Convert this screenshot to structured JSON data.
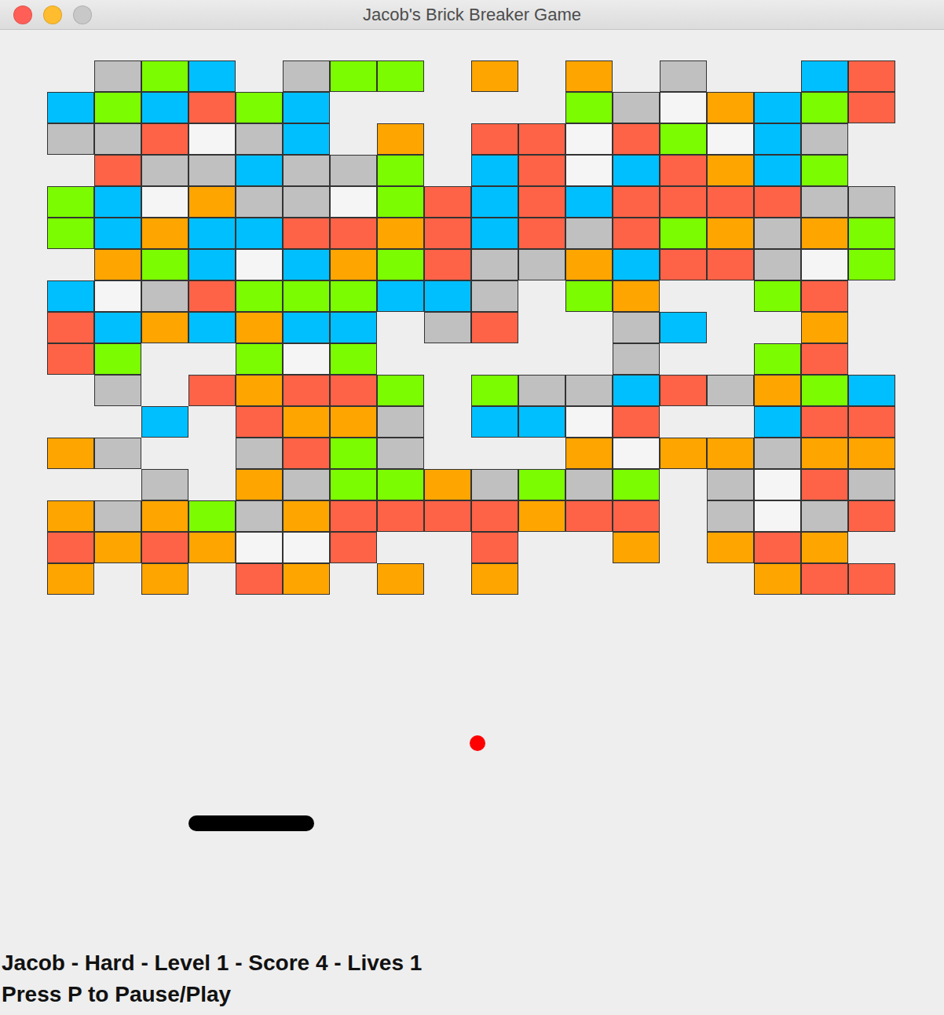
{
  "window": {
    "title": "Jacob's Brick Breaker Game",
    "controls": [
      {
        "color": "#ff5f57"
      },
      {
        "color": "#febc2e"
      },
      {
        "color": "#c8c8c8"
      }
    ]
  },
  "bricks": [
    [
      null,
      "#c0c0c0",
      "#7cfc00",
      "#00bfff",
      null,
      "#c0c0c0",
      "#7cfc00",
      "#7cfc00",
      null,
      "#ffa500",
      null,
      "#ffa500",
      null,
      "#c0c0c0",
      null,
      null,
      "#00bfff",
      "#ff6347"
    ],
    [
      "#00bfff",
      "#7cfc00",
      "#00bfff",
      "#ff6347",
      "#7cfc00",
      "#00bfff",
      null,
      null,
      null,
      null,
      null,
      "#7cfc00",
      "#c0c0c0",
      "#f5f5f5",
      "#ffa500",
      "#00bfff",
      "#7cfc00",
      "#ff6347"
    ],
    [
      "#c0c0c0",
      "#c0c0c0",
      "#ff6347",
      "#f5f5f5",
      "#c0c0c0",
      "#00bfff",
      null,
      "#ffa500",
      null,
      "#ff6347",
      "#ff6347",
      "#f5f5f5",
      "#ff6347",
      "#7cfc00",
      "#f5f5f5",
      "#00bfff",
      "#c0c0c0",
      null
    ],
    [
      null,
      "#ff6347",
      "#c0c0c0",
      "#c0c0c0",
      "#00bfff",
      "#c0c0c0",
      "#c0c0c0",
      "#7cfc00",
      null,
      "#00bfff",
      "#ff6347",
      "#f5f5f5",
      "#00bfff",
      "#ff6347",
      "#ffa500",
      "#00bfff",
      "#7cfc00",
      null
    ],
    [
      "#7cfc00",
      "#00bfff",
      "#f5f5f5",
      "#ffa500",
      "#c0c0c0",
      "#c0c0c0",
      "#f5f5f5",
      "#7cfc00",
      "#ff6347",
      "#00bfff",
      "#ff6347",
      "#00bfff",
      "#ff6347",
      "#ff6347",
      "#ff6347",
      "#ff6347",
      "#c0c0c0",
      "#c0c0c0"
    ],
    [
      "#7cfc00",
      "#00bfff",
      "#ffa500",
      "#00bfff",
      "#00bfff",
      "#ff6347",
      "#ff6347",
      "#ffa500",
      "#ff6347",
      "#00bfff",
      "#ff6347",
      "#c0c0c0",
      "#ff6347",
      "#7cfc00",
      "#ffa500",
      "#c0c0c0",
      "#ffa500",
      "#7cfc00"
    ],
    [
      null,
      "#ffa500",
      "#7cfc00",
      "#00bfff",
      "#f5f5f5",
      "#00bfff",
      "#ffa500",
      "#7cfc00",
      "#ff6347",
      "#c0c0c0",
      "#c0c0c0",
      "#ffa500",
      "#00bfff",
      "#ff6347",
      "#ff6347",
      "#c0c0c0",
      "#f5f5f5",
      "#7cfc00"
    ],
    [
      "#00bfff",
      "#f5f5f5",
      "#c0c0c0",
      "#ff6347",
      "#7cfc00",
      "#7cfc00",
      "#7cfc00",
      "#00bfff",
      "#00bfff",
      "#c0c0c0",
      null,
      "#7cfc00",
      "#ffa500",
      null,
      null,
      "#7cfc00",
      "#ff6347",
      null
    ],
    [
      "#ff6347",
      "#00bfff",
      "#ffa500",
      "#00bfff",
      "#ffa500",
      "#00bfff",
      "#00bfff",
      null,
      "#c0c0c0",
      "#ff6347",
      null,
      null,
      "#c0c0c0",
      "#00bfff",
      null,
      null,
      "#ffa500",
      null
    ],
    [
      "#ff6347",
      "#7cfc00",
      null,
      null,
      "#7cfc00",
      "#f5f5f5",
      "#7cfc00",
      null,
      null,
      null,
      null,
      null,
      "#c0c0c0",
      null,
      null,
      "#7cfc00",
      "#ff6347",
      null
    ],
    [
      null,
      "#c0c0c0",
      null,
      "#ff6347",
      "#ffa500",
      "#ff6347",
      "#ff6347",
      "#7cfc00",
      null,
      "#7cfc00",
      "#c0c0c0",
      "#c0c0c0",
      "#00bfff",
      "#ff6347",
      "#c0c0c0",
      "#ffa500",
      "#7cfc00",
      "#00bfff"
    ],
    [
      null,
      null,
      "#00bfff",
      null,
      "#ff6347",
      "#ffa500",
      "#ffa500",
      "#c0c0c0",
      null,
      "#00bfff",
      "#00bfff",
      "#f5f5f5",
      "#ff6347",
      null,
      null,
      "#00bfff",
      "#ff6347",
      "#ff6347"
    ],
    [
      "#ffa500",
      "#c0c0c0",
      null,
      null,
      "#c0c0c0",
      "#ff6347",
      "#7cfc00",
      "#c0c0c0",
      null,
      null,
      null,
      "#ffa500",
      "#f5f5f5",
      "#ffa500",
      "#ffa500",
      "#c0c0c0",
      "#ffa500",
      "#ffa500"
    ],
    [
      null,
      null,
      "#c0c0c0",
      null,
      "#ffa500",
      "#c0c0c0",
      "#7cfc00",
      "#7cfc00",
      "#ffa500",
      "#c0c0c0",
      "#7cfc00",
      "#c0c0c0",
      "#7cfc00",
      null,
      "#c0c0c0",
      "#f5f5f5",
      "#ff6347",
      "#c0c0c0"
    ],
    [
      "#ffa500",
      "#c0c0c0",
      "#ffa500",
      "#7cfc00",
      "#c0c0c0",
      "#ffa500",
      "#ff6347",
      "#ff6347",
      "#ff6347",
      "#ff6347",
      "#ffa500",
      "#ff6347",
      "#ff6347",
      null,
      "#c0c0c0",
      "#f5f5f5",
      "#c0c0c0",
      "#ff6347"
    ],
    [
      "#ff6347",
      "#ffa500",
      "#ff6347",
      "#ffa500",
      "#f5f5f5",
      "#f5f5f5",
      "#ff6347",
      null,
      null,
      "#ff6347",
      null,
      null,
      "#ffa500",
      null,
      "#ffa500",
      "#ff6347",
      "#ffa500",
      null
    ],
    [
      "#ffa500",
      null,
      "#ffa500",
      null,
      "#ff6347",
      "#ffa500",
      null,
      "#ffa500",
      null,
      "#ffa500",
      null,
      null,
      null,
      null,
      null,
      "#ffa500",
      "#ff6347",
      "#ff6347"
    ]
  ],
  "ball": {
    "color": "#ff0000"
  },
  "paddle": {
    "color": "#000000"
  },
  "status": [
    "Jacob - Hard - Level 1 - Score 4 - Lives 1",
    "Press P to Pause/Play"
  ]
}
